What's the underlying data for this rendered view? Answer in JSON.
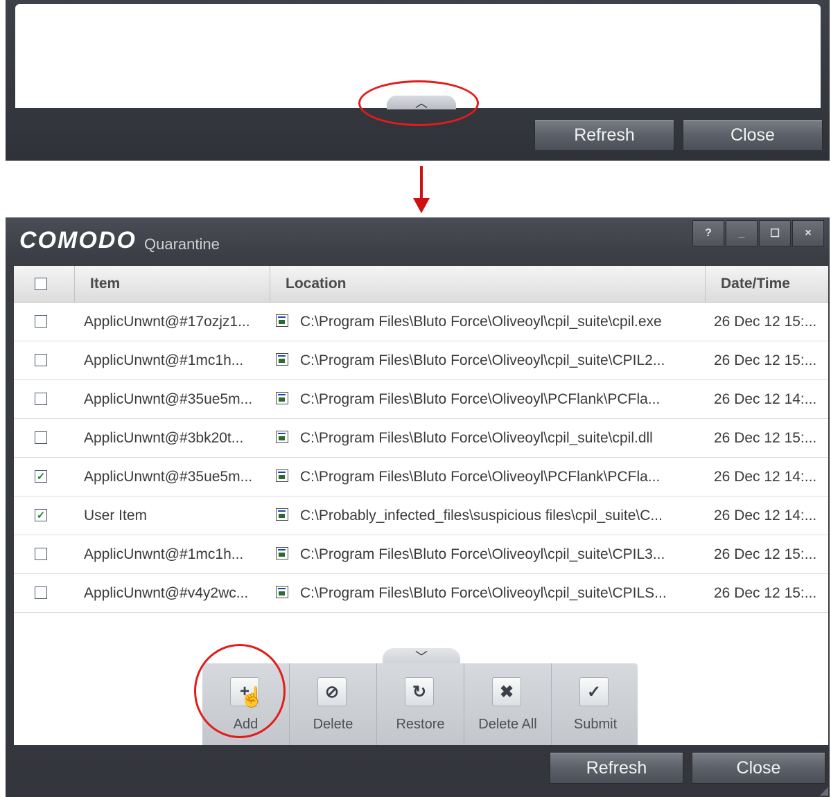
{
  "top_panel": {
    "expand_glyph": "︿",
    "refresh_label": "Refresh",
    "close_label": "Close"
  },
  "window": {
    "logo": "COMODO",
    "title": "Quarantine",
    "controls": {
      "help": "?",
      "minimize": "_",
      "maximize": "☐",
      "close": "×"
    }
  },
  "table": {
    "columns": {
      "item": "Item",
      "location": "Location",
      "datetime": "Date/Time"
    },
    "rows": [
      {
        "checked": false,
        "item": "ApplicUnwnt@#17ozjz1...",
        "location": "C:\\Program Files\\Bluto Force\\Oliveoyl\\cpil_suite\\cpil.exe",
        "datetime": "26 Dec 12 15:..."
      },
      {
        "checked": false,
        "item": "ApplicUnwnt@#1mc1h...",
        "location": "C:\\Program Files\\Bluto Force\\Oliveoyl\\cpil_suite\\CPIL2...",
        "datetime": "26 Dec 12 15:..."
      },
      {
        "checked": false,
        "item": "ApplicUnwnt@#35ue5m...",
        "location": "C:\\Program Files\\Bluto Force\\Oliveoyl\\PCFlank\\PCFla...",
        "datetime": "26 Dec 12 14:..."
      },
      {
        "checked": false,
        "item": "ApplicUnwnt@#3bk20t...",
        "location": "C:\\Program Files\\Bluto Force\\Oliveoyl\\cpil_suite\\cpil.dll",
        "datetime": "26 Dec 12 15:..."
      },
      {
        "checked": true,
        "item": "ApplicUnwnt@#35ue5m...",
        "location": "C:\\Program Files\\Bluto Force\\Oliveoyl\\PCFlank\\PCFla...",
        "datetime": "26 Dec 12 14:..."
      },
      {
        "checked": true,
        "item": "User Item",
        "location": "C:\\Probably_infected_files\\suspicious files\\cpil_suite\\C...",
        "datetime": "26 Dec 12 14:..."
      },
      {
        "checked": false,
        "item": "ApplicUnwnt@#1mc1h...",
        "location": "C:\\Program Files\\Bluto Force\\Oliveoyl\\cpil_suite\\CPIL3...",
        "datetime": "26 Dec 12 15:..."
      },
      {
        "checked": false,
        "item": "ApplicUnwnt@#v4y2wc...",
        "location": "C:\\Program Files\\Bluto Force\\Oliveoyl\\cpil_suite\\CPILS...",
        "datetime": "26 Dec 12 15:..."
      }
    ]
  },
  "toolbar": {
    "collapse_glyph": "﹀",
    "tools": [
      {
        "label": "Add",
        "icon": "plus-icon",
        "glyph": "+"
      },
      {
        "label": "Delete",
        "icon": "block-icon",
        "glyph": "⊘"
      },
      {
        "label": "Restore",
        "icon": "restore-icon",
        "glyph": "↻"
      },
      {
        "label": "Delete All",
        "icon": "x-icon",
        "glyph": "✖"
      },
      {
        "label": "Submit",
        "icon": "check-icon",
        "glyph": "✓"
      }
    ]
  },
  "bottom": {
    "refresh_label": "Refresh",
    "close_label": "Close"
  },
  "colors": {
    "highlight": "#e31b1b",
    "arrow": "#d01010",
    "window_bg": "#3a3d44",
    "check": "#1f8a2a"
  }
}
